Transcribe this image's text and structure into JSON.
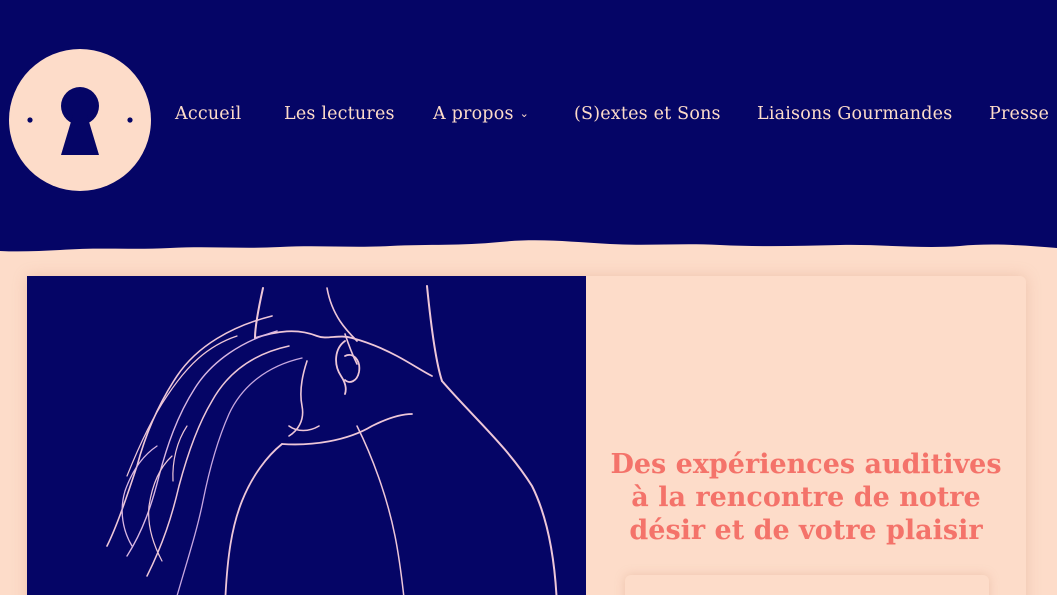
{
  "colors": {
    "navy": "#050566",
    "peach": "#fddcc9",
    "coral": "#f4736a"
  },
  "header": {
    "logo": "keyhole-logo",
    "nav": [
      {
        "label": "Accueil"
      },
      {
        "label": "Les lectures"
      },
      {
        "label": "A propos",
        "has_dropdown": true,
        "caret": "⌄"
      },
      {
        "label": "(S)extes et Sons"
      },
      {
        "label": "Liaisons Gourmandes"
      },
      {
        "label": "Presse"
      }
    ]
  },
  "hero": {
    "image": "line-drawing-couple-embrace",
    "tagline": "Des expériences auditives à la rencontre de notre désir et de votre plaisir"
  }
}
